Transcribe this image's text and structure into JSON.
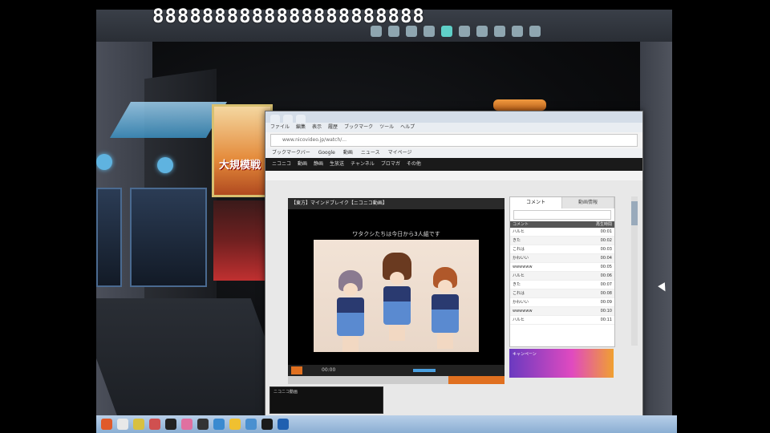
{
  "game": {
    "score": "8888888888888888888888",
    "banner_text": "大規模戦"
  },
  "browser": {
    "tabs": [
      "",
      "",
      ""
    ],
    "menu": [
      "ファイル",
      "編集",
      "表示",
      "履歴",
      "ブックマーク",
      "ツール",
      "ヘルプ"
    ],
    "address": "www.nicovideo.jp/watch/...",
    "bookmarks": [
      "ブックマークバー",
      "Google",
      "動画",
      "ニュース",
      "マイページ"
    ],
    "site_nav": [
      "ニコニコ",
      "動画",
      "静画",
      "生放送",
      "チャンネル",
      "ブロマガ",
      "その他"
    ]
  },
  "player": {
    "title": "【東方】マインドブレイク【ニコニコ動画】",
    "overlay_comment": "ワタクシたちは今日から3人組です",
    "time": "00:00",
    "progress_fraction": 0.74
  },
  "comments": {
    "tabs": [
      "コメント",
      "動画情報"
    ],
    "search_placeholder": "",
    "header_left": "コメント",
    "header_right": "再生時間",
    "rows": [
      {
        "text": "ハルヒ",
        "time": "00:01"
      },
      {
        "text": "きた",
        "time": "00:02"
      },
      {
        "text": "これは",
        "time": "00:03"
      },
      {
        "text": "かわいい",
        "time": "00:04"
      },
      {
        "text": "wwwwww",
        "time": "00:05"
      },
      {
        "text": "ハルヒ",
        "time": "00:06"
      },
      {
        "text": "きた",
        "time": "00:07"
      },
      {
        "text": "これは",
        "time": "00:08"
      },
      {
        "text": "かわいい",
        "time": "00:09"
      },
      {
        "text": "wwwwww",
        "time": "00:10"
      },
      {
        "text": "ハルヒ",
        "time": "00:11"
      }
    ]
  },
  "ad": {
    "text": "キャンペーン"
  },
  "notification": {
    "text": "ニコニコ動画"
  },
  "taskbar": {
    "clock_time": "",
    "clock_date": ""
  },
  "colors": {
    "accent": "#e07020",
    "highlight": "#5fb3e0"
  }
}
